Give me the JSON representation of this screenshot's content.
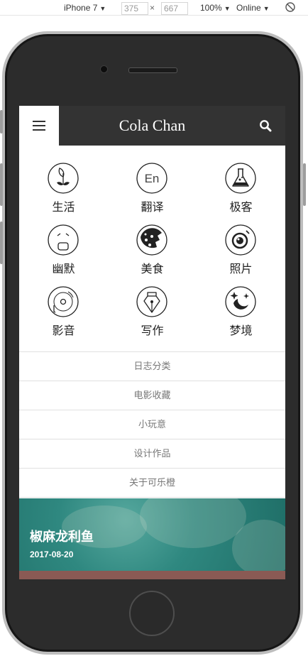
{
  "devtools": {
    "device": "iPhone 7",
    "width": "375",
    "height": "667",
    "times": "×",
    "zoom": "100%",
    "network": "Online"
  },
  "site": {
    "title": "Cola Chan",
    "categories": [
      {
        "label": "生活",
        "icon": "sprout-icon"
      },
      {
        "label": "翻译",
        "icon": "translate-icon"
      },
      {
        "label": "极客",
        "icon": "flask-icon"
      },
      {
        "label": "幽默",
        "icon": "funny-face-icon"
      },
      {
        "label": "美食",
        "icon": "cookie-icon"
      },
      {
        "label": "照片",
        "icon": "camera-lens-icon"
      },
      {
        "label": "影音",
        "icon": "vinyl-record-icon"
      },
      {
        "label": "写作",
        "icon": "pen-nib-icon"
      },
      {
        "label": "梦境",
        "icon": "moon-stars-icon"
      }
    ],
    "links": [
      "日志分类",
      "电影收藏",
      "小玩意",
      "设计作品",
      "关于可乐橙"
    ],
    "post": {
      "title": "椒麻龙利鱼",
      "date": "2017-08-20"
    }
  },
  "colors": {
    "header": "#333333",
    "accent": "#2f8880"
  }
}
